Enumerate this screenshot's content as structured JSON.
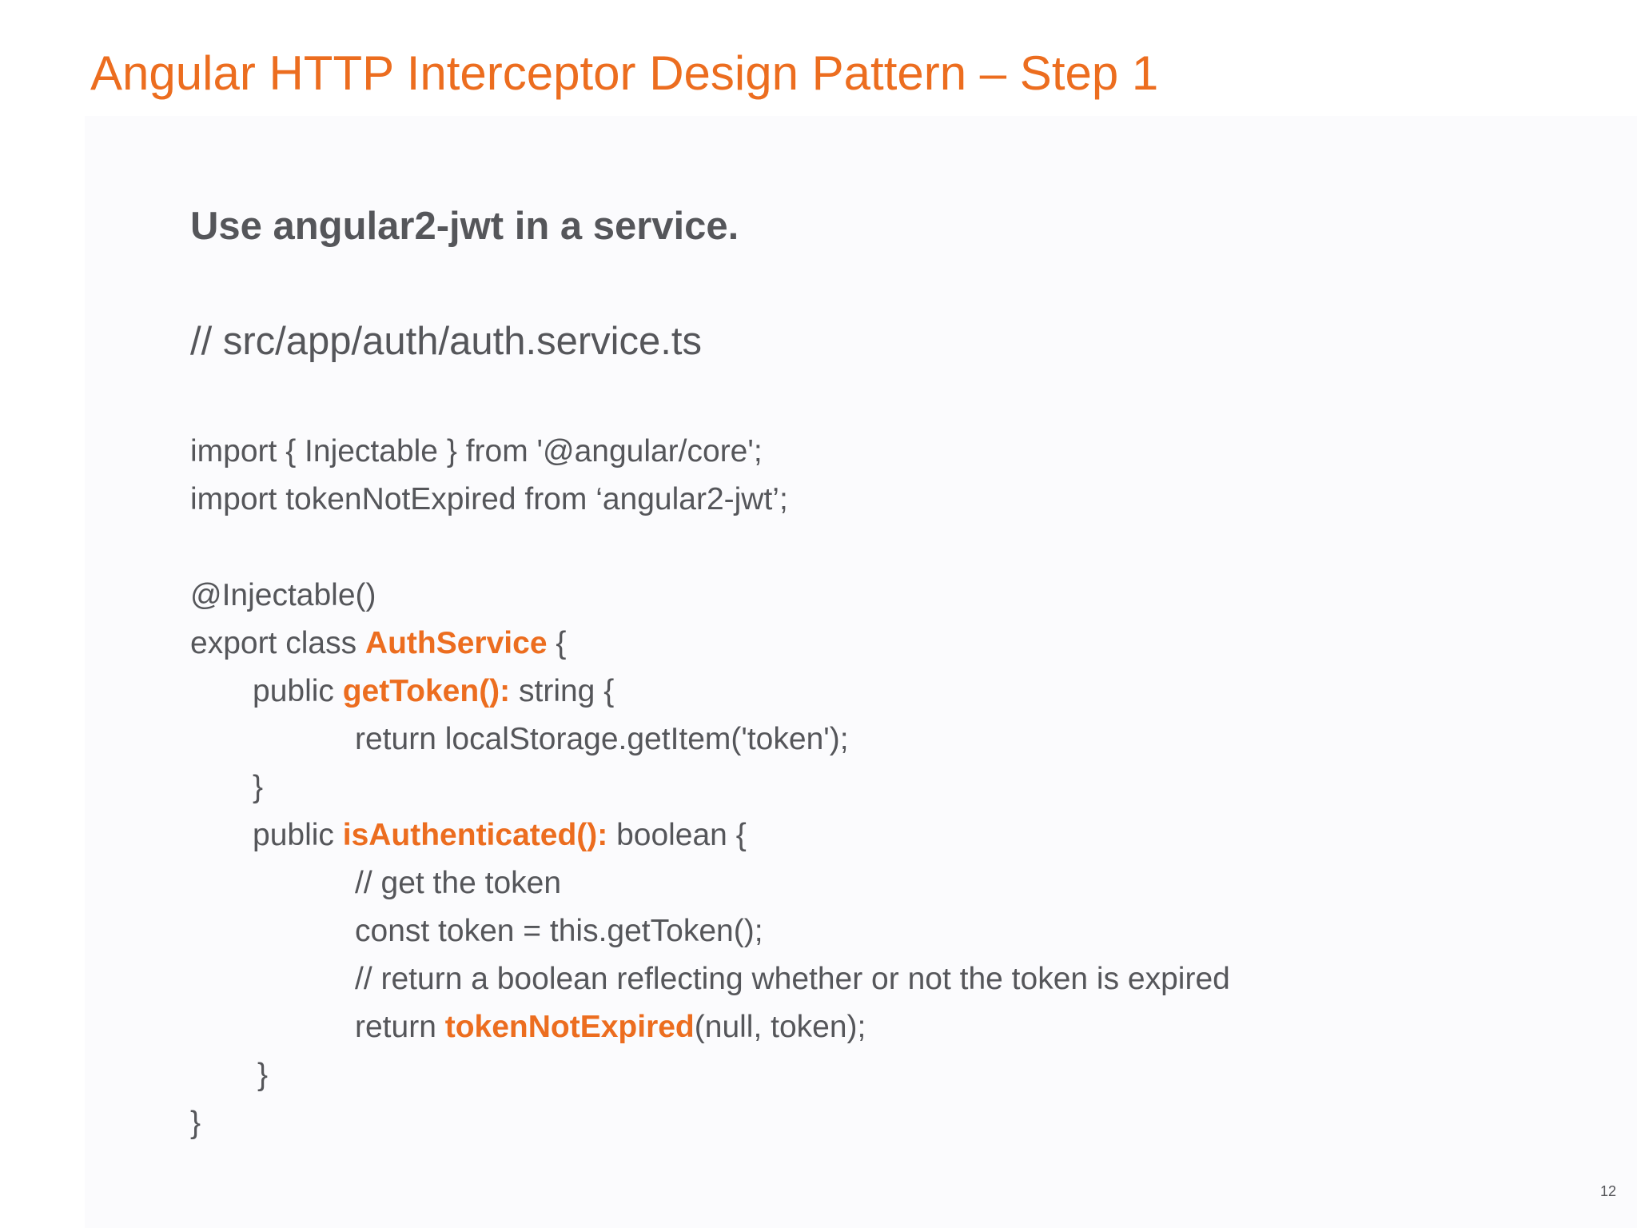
{
  "colors": {
    "accent": "#ec6d1f",
    "text": "#55565a",
    "background": "#fbfbfd"
  },
  "slide": {
    "title": "Angular HTTP Interceptor Design Pattern – Step 1",
    "subtitle": "Use angular2-jwt in a service.",
    "file_path": "// src/app/auth/auth.service.ts",
    "page_number": "12"
  },
  "code": {
    "import_line_1": "import { Injectable } from '@angular/core';",
    "import_line_2": "import tokenNotExpired from ‘angular2-jwt’;",
    "decorator": "@Injectable()",
    "class_prefix": "export class ",
    "class_name": "AuthService",
    "class_suffix": " {",
    "get_token_prefix": "public ",
    "get_token_name": "getToken():",
    "get_token_suffix": " string {",
    "get_token_return": "return localStorage.getItem('token');",
    "close_brace_get_token": "}",
    "is_auth_prefix": "public ",
    "is_auth_name": "isAuthenticated():",
    "is_auth_suffix": " boolean {",
    "comment_get_token": "// get the token",
    "const_token": "const token = this.getToken();",
    "comment_return": "// return a boolean reflecting whether or not the token is expired",
    "return_prefix": "return ",
    "return_call": "tokenNotExpired",
    "return_suffix": "(null, token);",
    "close_brace_is_auth": "}",
    "close_brace_class": "}"
  }
}
